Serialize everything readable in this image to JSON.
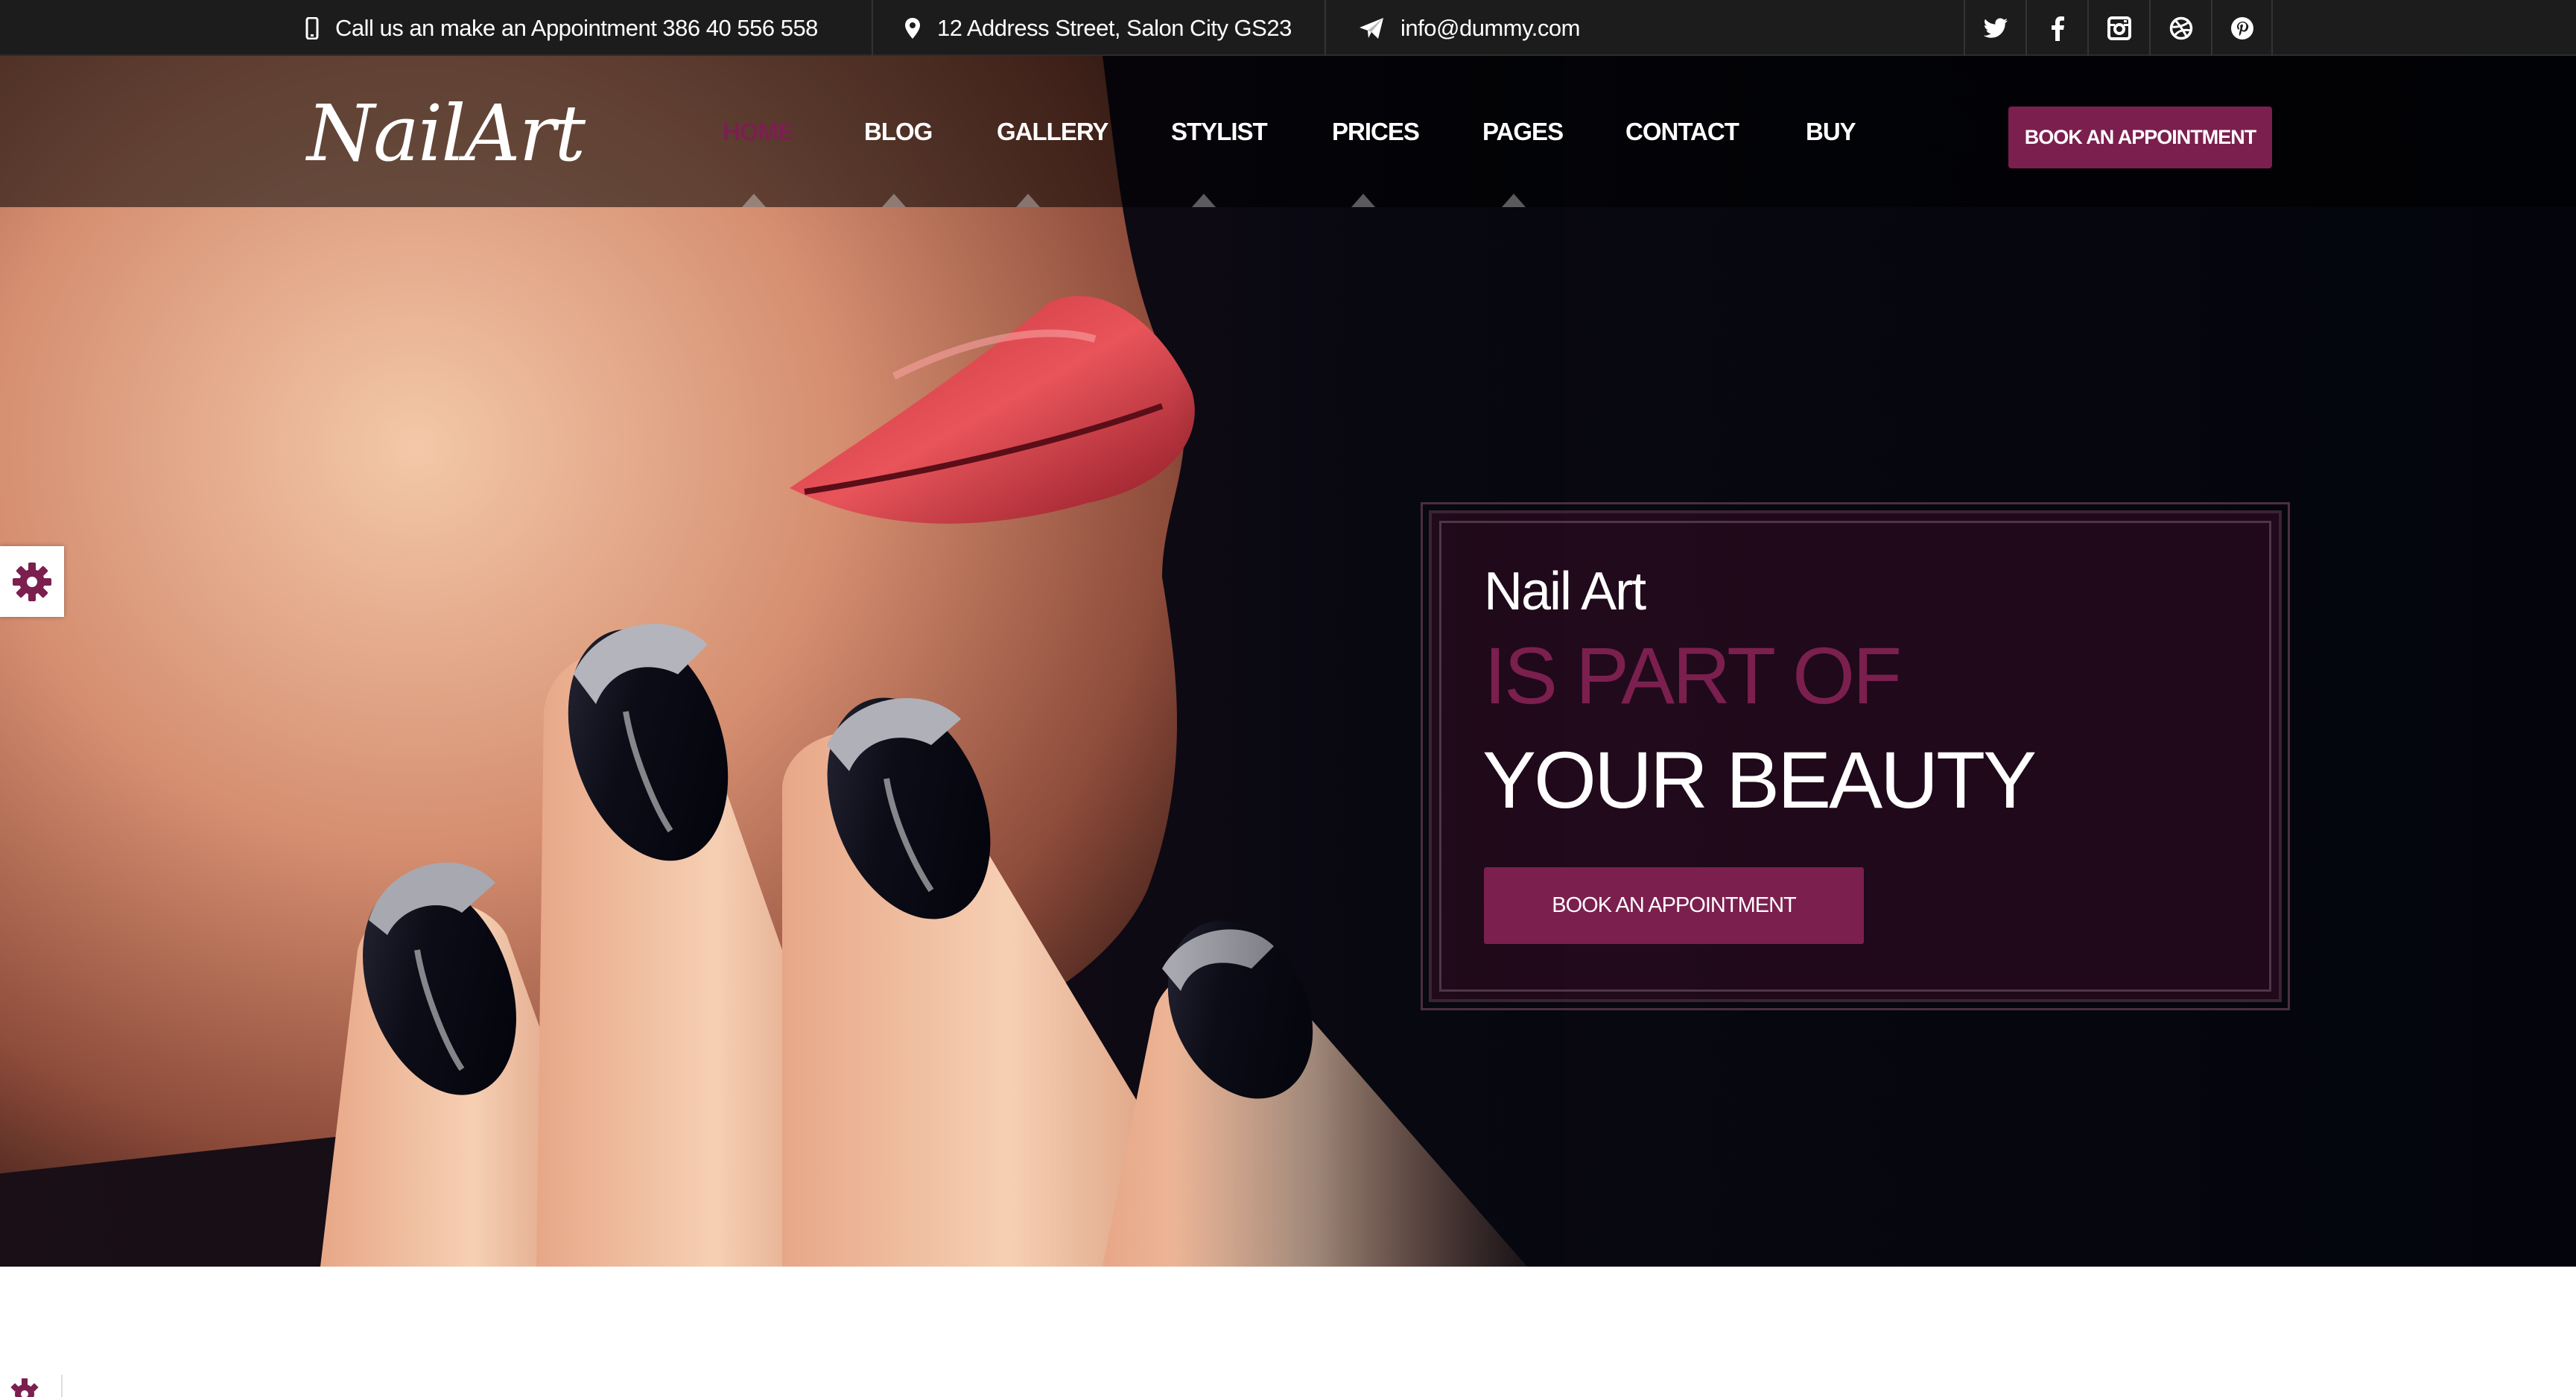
{
  "topbar": {
    "phone": {
      "icon": "mobile-icon",
      "text": "Call us an make an Appointment 386 40 556 558"
    },
    "address": {
      "icon": "map-marker-icon",
      "text": "12 Address Street, Salon City GS23"
    },
    "email": {
      "icon": "paper-plane-icon",
      "text": "info@dummy.com"
    },
    "social": [
      "twitter-icon",
      "facebook-icon",
      "instagram-icon",
      "dribbble-icon",
      "pinterest-icon"
    ]
  },
  "header": {
    "logo": "NailArt",
    "nav": [
      {
        "label": "HOME",
        "active": true
      },
      {
        "label": "BLOG",
        "active": false
      },
      {
        "label": "GALLERY",
        "active": false
      },
      {
        "label": "STYLIST",
        "active": false
      },
      {
        "label": "PRICES",
        "active": false
      },
      {
        "label": "PAGES",
        "active": false
      },
      {
        "label": "CONTACT",
        "active": false
      },
      {
        "label": "BUY",
        "active": false
      }
    ],
    "cta": "BOOK AN APPOINTMENT"
  },
  "hero": {
    "line1": "Nail Art",
    "line2": "IS PART OF",
    "line3": "YOUR BEAUTY",
    "button": "BOOK AN APPOINTMENT"
  },
  "theme": {
    "accent": "#7b1f4f",
    "topbar_bg": "#1c1c1c",
    "hero_dark": "#06070f"
  }
}
